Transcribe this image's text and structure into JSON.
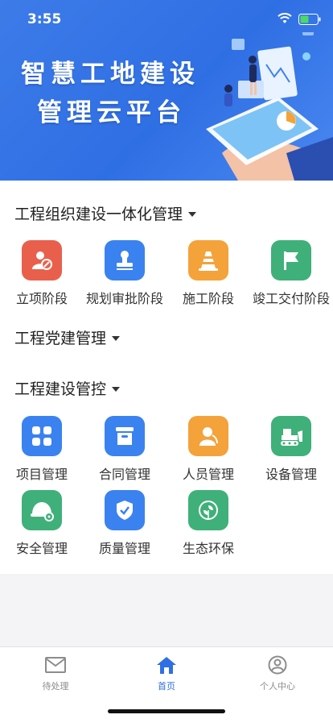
{
  "status": {
    "time": "3:55"
  },
  "banner": {
    "line1": "智慧工地建设",
    "line2": "管理云平台"
  },
  "sections": {
    "org": {
      "title": "工程组织建设一体化管理",
      "items": [
        {
          "label": "立项阶段",
          "icon": "project-approval-icon",
          "color": "#e8604c"
        },
        {
          "label": "规划审批阶段",
          "icon": "stamp-icon",
          "color": "#3a82ef"
        },
        {
          "label": "施工阶段",
          "icon": "traffic-cone-icon",
          "color": "#f4a23a"
        },
        {
          "label": "竣工交付阶段",
          "icon": "flag-icon",
          "color": "#3fb079"
        }
      ]
    },
    "party": {
      "title": "工程党建管理"
    },
    "control": {
      "title": "工程建设管控",
      "items": [
        {
          "label": "项目管理",
          "icon": "grid-icon",
          "color": "#3a82ef"
        },
        {
          "label": "合同管理",
          "icon": "archive-box-icon",
          "color": "#3a82ef"
        },
        {
          "label": "人员管理",
          "icon": "person-icon",
          "color": "#f4a23a"
        },
        {
          "label": "设备管理",
          "icon": "bulldozer-icon",
          "color": "#3fb079"
        },
        {
          "label": "安全管理",
          "icon": "safety-helmet-icon",
          "color": "#3fb079"
        },
        {
          "label": "质量管理",
          "icon": "shield-check-icon",
          "color": "#3a82ef"
        },
        {
          "label": "生态环保",
          "icon": "leaf-icon",
          "color": "#3fb079"
        }
      ]
    }
  },
  "tabbar": {
    "items": [
      {
        "label": "待处理",
        "icon": "mail-icon"
      },
      {
        "label": "首页",
        "icon": "home-icon",
        "active": true
      },
      {
        "label": "个人中心",
        "icon": "user-icon"
      }
    ],
    "active_color": "#2f6fe4"
  }
}
